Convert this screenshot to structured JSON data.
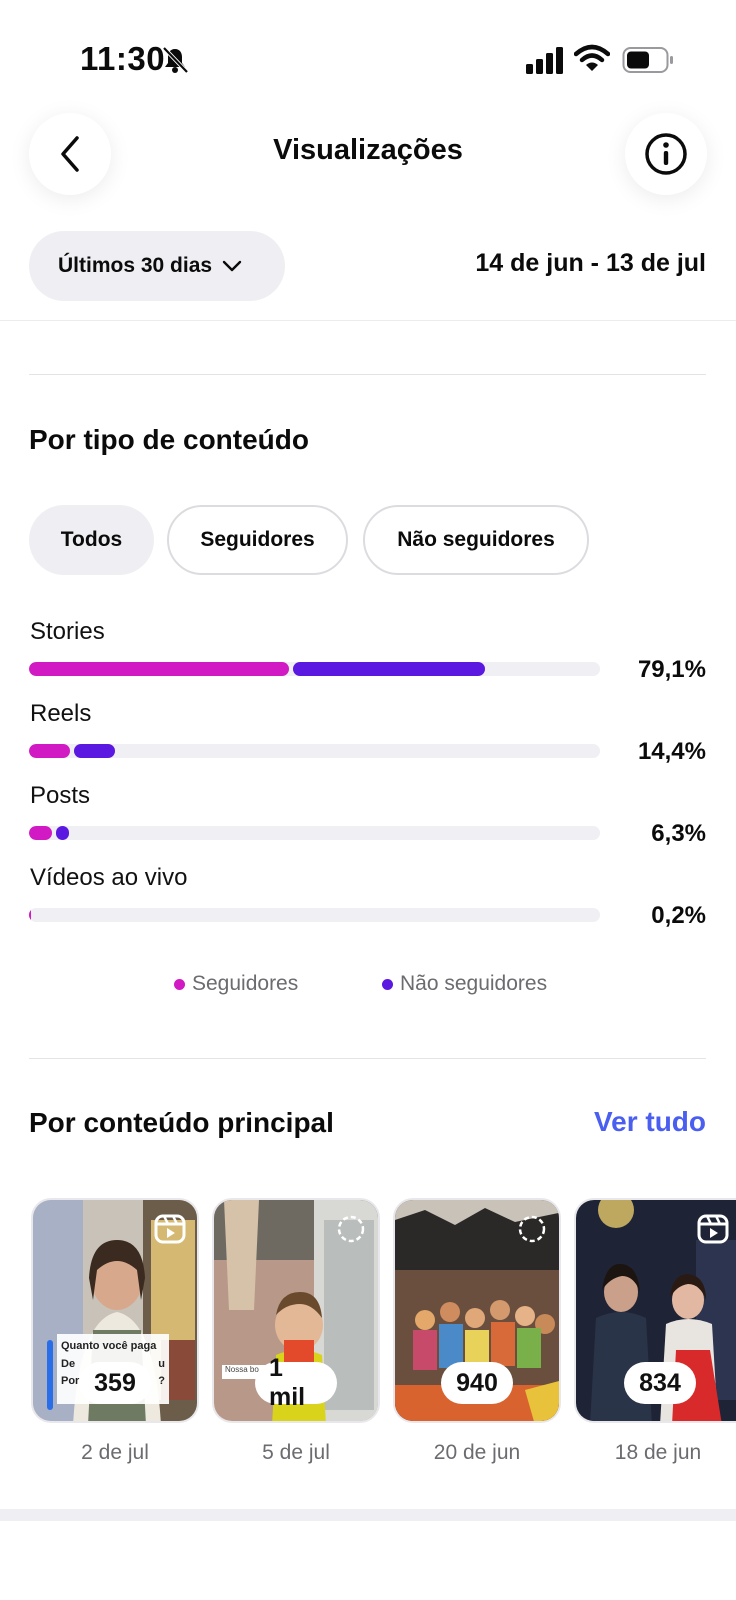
{
  "status_bar": {
    "time": "11:30",
    "icons": [
      "bell-slash-icon",
      "signal-icon",
      "wifi-icon",
      "battery-icon"
    ]
  },
  "header": {
    "title": "Visualizações",
    "back_icon": "chevron-left-icon",
    "info_icon": "info-icon"
  },
  "filters": {
    "period_label": "Últimos 30 dias",
    "date_range": "14 de jun - 13 de jul"
  },
  "content_type": {
    "title": "Por tipo de conteúdo",
    "tabs": [
      {
        "label": "Todos",
        "selected": true
      },
      {
        "label": "Seguidores",
        "selected": false
      },
      {
        "label": "Não seguidores",
        "selected": false
      }
    ],
    "rows": [
      {
        "label": "Stories",
        "percent": "79,1%",
        "followers_fraction": 0.455,
        "non_followers_fraction": 0.336
      },
      {
        "label": "Reels",
        "percent": "14,4%",
        "followers_fraction": 0.072,
        "non_followers_fraction": 0.072
      },
      {
        "label": "Posts",
        "percent": "6,3%",
        "followers_fraction": 0.04,
        "non_followers_fraction": 0.023
      },
      {
        "label": "Vídeos ao vivo",
        "percent": "0,2%",
        "followers_fraction": 0.002,
        "non_followers_fraction": 0.0
      }
    ],
    "legend": [
      {
        "label": "Seguidores",
        "color": "#d119c4"
      },
      {
        "label": "Não seguidores",
        "color": "#5b18e0"
      }
    ]
  },
  "top_content": {
    "title": "Por conteúdo principal",
    "see_all": "Ver tudo",
    "items": [
      {
        "count": "359",
        "date": "2 de jul",
        "type_icon": "reels-icon",
        "caption": "Quanto você paga",
        "caption_2": "De",
        "caption_3": "u",
        "caption_4": "Por",
        "caption_5": "?"
      },
      {
        "count": "1 mil",
        "date": "5 de jul",
        "type_icon": "story-circle-icon",
        "caption": "Nossa bo"
      },
      {
        "count": "940",
        "date": "20 de jun",
        "type_icon": "story-circle-icon"
      },
      {
        "count": "834",
        "date": "18 de jun",
        "type_icon": "reels-icon"
      }
    ]
  },
  "colors": {
    "followers": "#d119c4",
    "non_followers": "#5b18e0",
    "link": "#4a5ef0"
  }
}
